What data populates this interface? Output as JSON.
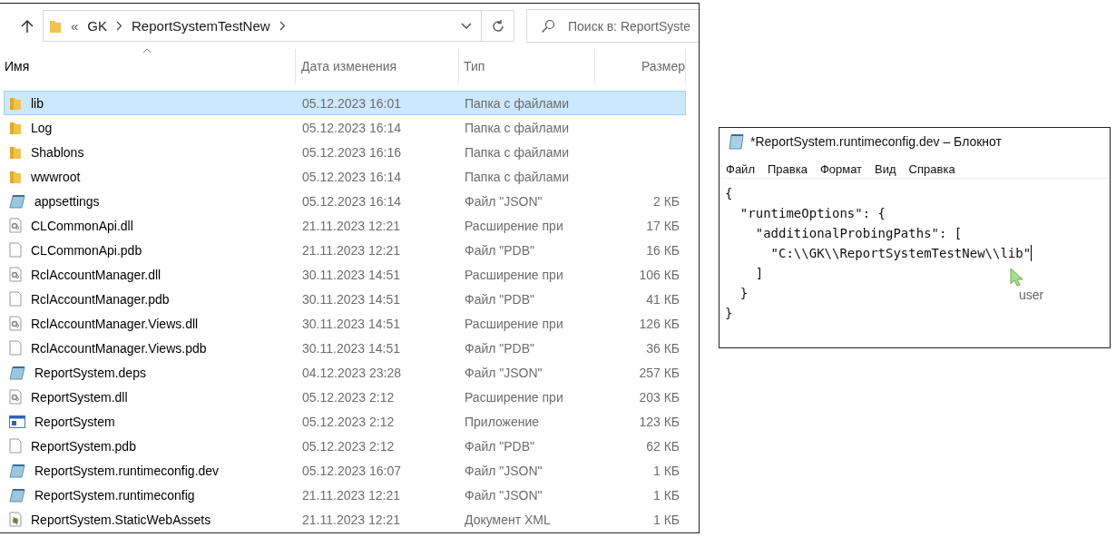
{
  "explorer": {
    "breadcrumb": [
      {
        "kind": "overflow",
        "label": "«"
      },
      {
        "kind": "folder",
        "label": "GK"
      },
      {
        "kind": "folder",
        "label": "ReportSystemTestNew"
      }
    ],
    "search": {
      "placeholder": "Поиск в: ReportSyste"
    },
    "columns": [
      "Имя",
      "Дата изменения",
      "Тип",
      "Размер"
    ],
    "rows": [
      {
        "kind": "folder",
        "name": "lib",
        "date": "05.12.2023 16:01",
        "type": "Папка с файлами",
        "size": "",
        "selected": true
      },
      {
        "kind": "folder",
        "name": "Log",
        "date": "05.12.2023 16:14",
        "type": "Папка с файлами",
        "size": "",
        "selected": false
      },
      {
        "kind": "folder",
        "name": "Shablons",
        "date": "05.12.2023 16:16",
        "type": "Папка с файлами",
        "size": "",
        "selected": false
      },
      {
        "kind": "folder",
        "name": "wwwroot",
        "date": "05.12.2023 16:14",
        "type": "Папка с файлами",
        "size": "",
        "selected": false
      },
      {
        "kind": "json",
        "name": "appsettings",
        "date": "05.12.2023 16:14",
        "type": "Файл \"JSON\"",
        "size": "2 КБ",
        "selected": false
      },
      {
        "kind": "dll",
        "name": "CLCommonApi.dll",
        "date": "21.11.2023 12:21",
        "type": "Расширение при",
        "size": "17 КБ",
        "selected": false
      },
      {
        "kind": "file",
        "name": "CLCommonApi.pdb",
        "date": "21.11.2023 12:21",
        "type": "Файл \"PDB\"",
        "size": "16 КБ",
        "selected": false
      },
      {
        "kind": "dll",
        "name": "RclAccountManager.dll",
        "date": "30.11.2023 14:51",
        "type": "Расширение при",
        "size": "106 КБ",
        "selected": false
      },
      {
        "kind": "file",
        "name": "RclAccountManager.pdb",
        "date": "30.11.2023 14:51",
        "type": "Файл \"PDB\"",
        "size": "41 КБ",
        "selected": false
      },
      {
        "kind": "dll",
        "name": "RclAccountManager.Views.dll",
        "date": "30.11.2023 14:51",
        "type": "Расширение при",
        "size": "126 КБ",
        "selected": false
      },
      {
        "kind": "file",
        "name": "RclAccountManager.Views.pdb",
        "date": "30.11.2023 14:51",
        "type": "Файл \"PDB\"",
        "size": "36 КБ",
        "selected": false
      },
      {
        "kind": "json",
        "name": "ReportSystem.deps",
        "date": "04.12.2023 23:28",
        "type": "Файл \"JSON\"",
        "size": "257 КБ",
        "selected": false
      },
      {
        "kind": "dll",
        "name": "ReportSystem.dll",
        "date": "05.12.2023 2:12",
        "type": "Расширение при",
        "size": "203 КБ",
        "selected": false
      },
      {
        "kind": "exe",
        "name": "ReportSystem",
        "date": "05.12.2023 2:12",
        "type": "Приложение",
        "size": "123 КБ",
        "selected": false
      },
      {
        "kind": "file",
        "name": "ReportSystem.pdb",
        "date": "05.12.2023 2:12",
        "type": "Файл \"PDB\"",
        "size": "62 КБ",
        "selected": false
      },
      {
        "kind": "json",
        "name": "ReportSystem.runtimeconfig.dev",
        "date": "05.12.2023 16:07",
        "type": "Файл \"JSON\"",
        "size": "1 КБ",
        "selected": false
      },
      {
        "kind": "json",
        "name": "ReportSystem.runtimeconfig",
        "date": "21.11.2023 12:21",
        "type": "Файл \"JSON\"",
        "size": "1 КБ",
        "selected": false
      },
      {
        "kind": "xml",
        "name": "ReportSystem.StaticWebAssets",
        "date": "21.11.2023 12:21",
        "type": "Документ XML",
        "size": "1 КБ",
        "selected": false
      }
    ]
  },
  "notepad": {
    "title": "*ReportSystem.runtimeconfig.dev – Блокнот",
    "menu": [
      "Файл",
      "Правка",
      "Формат",
      "Вид",
      "Справка"
    ],
    "lines": [
      "{",
      "  \"runtimeOptions\": {",
      "    \"additionalProbingPaths\": [",
      "      \"C:\\\\GK\\\\ReportSystemTestNew\\\\lib\"",
      "    ]",
      "  }",
      "}"
    ],
    "cursor_label": "user"
  }
}
